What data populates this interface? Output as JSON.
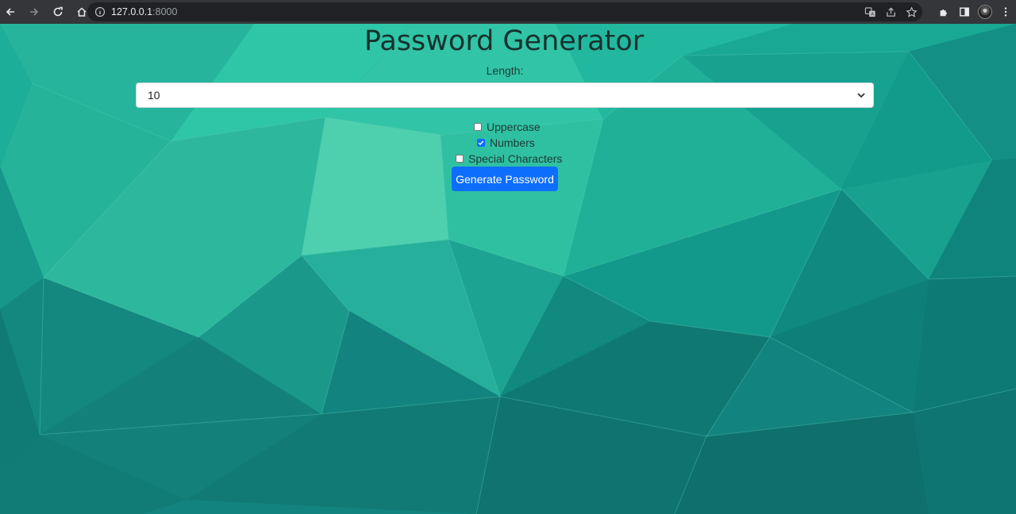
{
  "browser": {
    "url_host": "127.0.0.1",
    "url_port": ":8000"
  },
  "page": {
    "title": "Password Generator",
    "length_label": "Length:",
    "length_value": "10",
    "options": [
      {
        "label": "Uppercase",
        "checked": false
      },
      {
        "label": "Numbers",
        "checked": true
      },
      {
        "label": "Special Characters",
        "checked": false
      }
    ],
    "generate_label": "Generate Password"
  },
  "colors": {
    "accent": "#0d6efd",
    "bg_teal": "#1a8f8a"
  }
}
